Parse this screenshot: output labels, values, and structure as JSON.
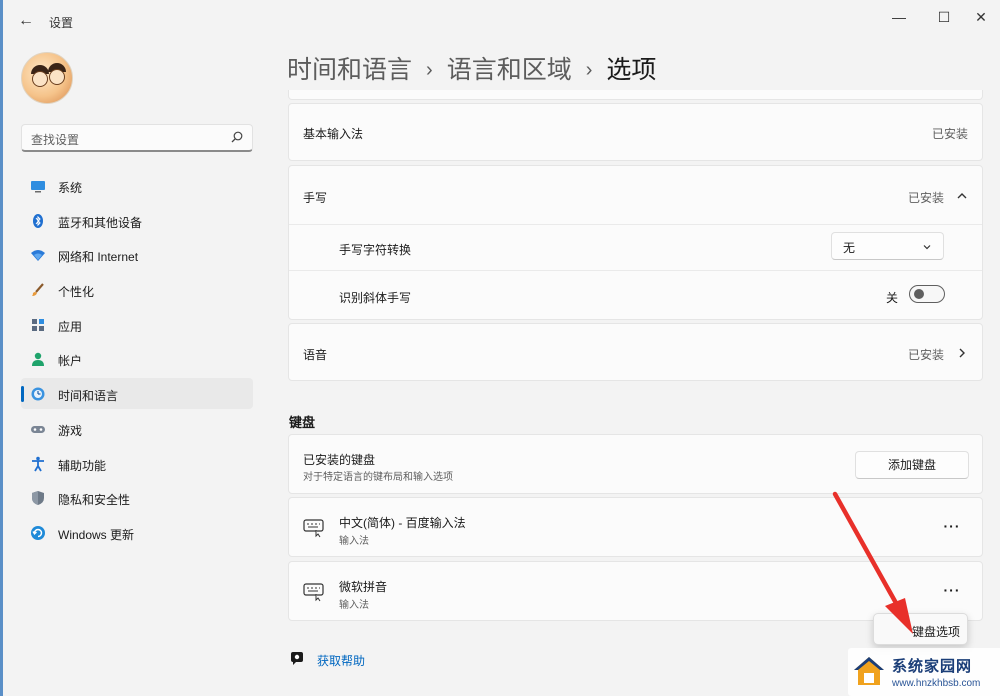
{
  "window": {
    "title": "设置",
    "back_glyph": "←",
    "minimize_glyph": "—",
    "maximize_glyph": "☐",
    "close_glyph": "✕"
  },
  "sidebar": {
    "search_placeholder": "查找设置",
    "items": [
      {
        "label": "系统",
        "icon": "monitor-icon"
      },
      {
        "label": "蓝牙和其他设备",
        "icon": "bluetooth-icon"
      },
      {
        "label": "网络和 Internet",
        "icon": "wifi-icon"
      },
      {
        "label": "个性化",
        "icon": "brush-icon"
      },
      {
        "label": "应用",
        "icon": "apps-icon"
      },
      {
        "label": "帐户",
        "icon": "person-icon"
      },
      {
        "label": "时间和语言",
        "icon": "clock-globe-icon",
        "active": true
      },
      {
        "label": "游戏",
        "icon": "gamepad-icon"
      },
      {
        "label": "辅助功能",
        "icon": "accessibility-icon"
      },
      {
        "label": "隐私和安全性",
        "icon": "shield-icon"
      },
      {
        "label": "Windows 更新",
        "icon": "update-icon"
      }
    ]
  },
  "breadcrumb": {
    "level1": "时间和语言",
    "level2": "语言和区域",
    "current": "选项",
    "separator": "›"
  },
  "content": {
    "basic_input": {
      "label": "基本输入法",
      "status": "已安装"
    },
    "handwriting": {
      "label": "手写",
      "status": "已安装",
      "char_conversion_label": "手写字符转换",
      "char_conversion_value": "无",
      "italic_label": "识别斜体手写",
      "italic_state": "关",
      "italic_on": false
    },
    "speech": {
      "label": "语音",
      "status": "已安装"
    },
    "keyboard_section": "键盘",
    "installed_keyboards": {
      "label": "已安装的键盘",
      "description": "对于特定语言的键布局和输入选项",
      "add_button": "添加键盘"
    },
    "keyboards": [
      {
        "name": "中文(简体) - 百度输入法",
        "type": "输入法"
      },
      {
        "name": "微软拼音",
        "type": "输入法"
      }
    ],
    "more_glyph": "···",
    "context_menu_item": "键盘选项",
    "get_help": "获取帮助"
  },
  "watermark": {
    "title": "系统家园网",
    "url": "www.hnzkhbsb.com"
  },
  "colors": {
    "accent": "#0067c0",
    "arrow": "#e8302a"
  }
}
